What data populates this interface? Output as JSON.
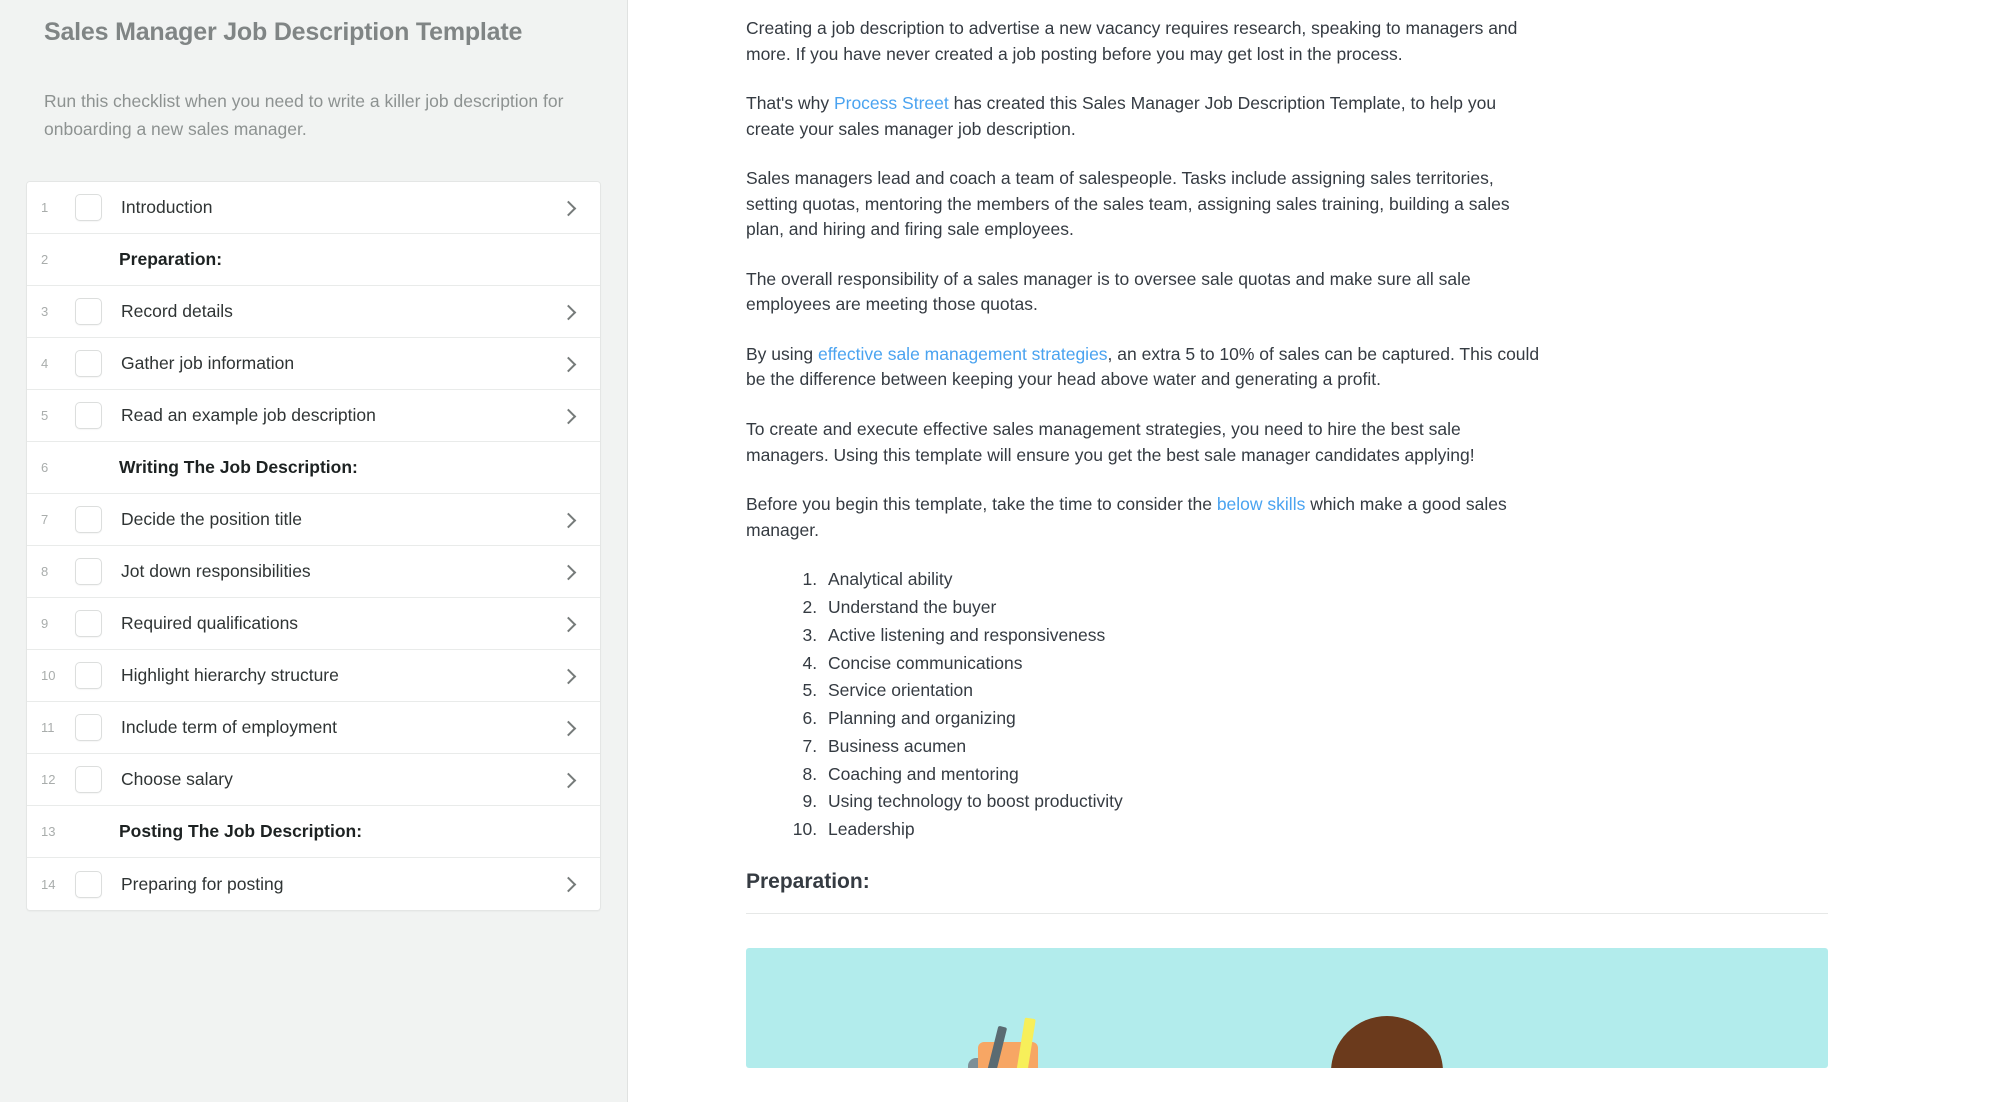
{
  "template": {
    "title": "Sales Manager Job Description Template",
    "description": "Run this checklist when you need to write a killer job description for onboarding a new sales manager.",
    "tasks": [
      {
        "index": "1",
        "label": "Introduction",
        "type": "task"
      },
      {
        "index": "2",
        "label": "Preparation:",
        "type": "heading"
      },
      {
        "index": "3",
        "label": "Record details",
        "type": "task"
      },
      {
        "index": "4",
        "label": "Gather job information",
        "type": "task"
      },
      {
        "index": "5",
        "label": "Read an example job description",
        "type": "task"
      },
      {
        "index": "6",
        "label": "Writing The Job Description:",
        "type": "heading"
      },
      {
        "index": "7",
        "label": "Decide the position title",
        "type": "task"
      },
      {
        "index": "8",
        "label": "Jot down responsibilities",
        "type": "task"
      },
      {
        "index": "9",
        "label": "Required qualifications",
        "type": "task"
      },
      {
        "index": "10",
        "label": "Highlight hierarchy structure",
        "type": "task"
      },
      {
        "index": "11",
        "label": "Include term of employment",
        "type": "task"
      },
      {
        "index": "12",
        "label": "Choose salary",
        "type": "task"
      },
      {
        "index": "13",
        "label": "Posting The Job Description:",
        "type": "heading"
      },
      {
        "index": "14",
        "label": "Preparing for posting",
        "type": "task"
      }
    ]
  },
  "document": {
    "paragraph_1": "Creating a job description to advertise a new vacancy requires research, speaking to managers and more. If you have never created a job posting before you may get lost in the process.",
    "paragraph_2": {
      "before": "That's why ",
      "link": "Process Street",
      "after": " has created this Sales Manager Job Description Template, to help you create your sales manager job description."
    },
    "paragraph_3": "Sales managers lead and coach a team of salespeople. Tasks include assigning sales territories, setting quotas, mentoring the members of the sales team, assigning sales training, building a sales plan, and hiring and firing sale employees.",
    "paragraph_4": "The overall responsibility of a sales manager is to oversee sale quotas and make sure all sale employees are meeting those quotas.",
    "paragraph_5": {
      "before": "By using ",
      "link": "effective sale management strategies",
      "after": ", an extra 5 to 10% of sales can be captured. This could be the difference between keeping your head above water and generating a profit."
    },
    "paragraph_6": "To create and execute effective sales management strategies, you need to hire the best sale managers. Using this template will ensure you get the best sale manager candidates applying!",
    "paragraph_7": {
      "before": "Before you begin this template, take the time to consider the ",
      "link": "below skills",
      "after": " which make a good sales manager."
    },
    "skills": [
      "Analytical ability",
      "Understand the buyer",
      "Active listening and responsiveness",
      "Concise communications",
      "Service orientation",
      "Planning and organizing",
      "Business acumen",
      "Coaching and mentoring",
      "Using technology to boost productivity",
      "Leadership"
    ],
    "section_heading": "Preparation:"
  },
  "colors": {
    "link": "#4aa3f0",
    "banner_background": "#b2ecec",
    "left_pane_background": "#f1f3f2",
    "title_text": "#808585",
    "body_text": "#353b42"
  }
}
